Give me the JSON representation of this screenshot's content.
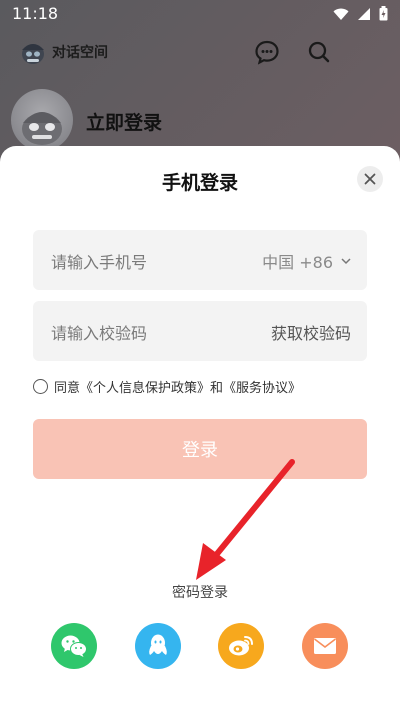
{
  "status_bar": {
    "time": "11:18"
  },
  "app_bar": {
    "app_name": "对话空间"
  },
  "profile": {
    "login_now": "立即登录"
  },
  "sheet": {
    "title": "手机登录",
    "phone_field": {
      "placeholder": "请输入手机号",
      "country_code": "中国 +86"
    },
    "code_field": {
      "placeholder": "请输入校验码",
      "get_code": "获取校验码"
    },
    "agreement": {
      "text": "同意《个人信息保护政策》和《服务协议》"
    },
    "login_button": "登录",
    "password_login": "密码登录",
    "social_logins": [
      "wechat-icon",
      "qq-icon",
      "weibo-icon",
      "email-icon"
    ]
  },
  "colors": {
    "login_button": "#f9c3b5",
    "wechat": "#2fc76c",
    "qq": "#35b5ef",
    "weibo": "#f7a81d",
    "email": "#f88e5b",
    "arrow": "#e8232a"
  }
}
